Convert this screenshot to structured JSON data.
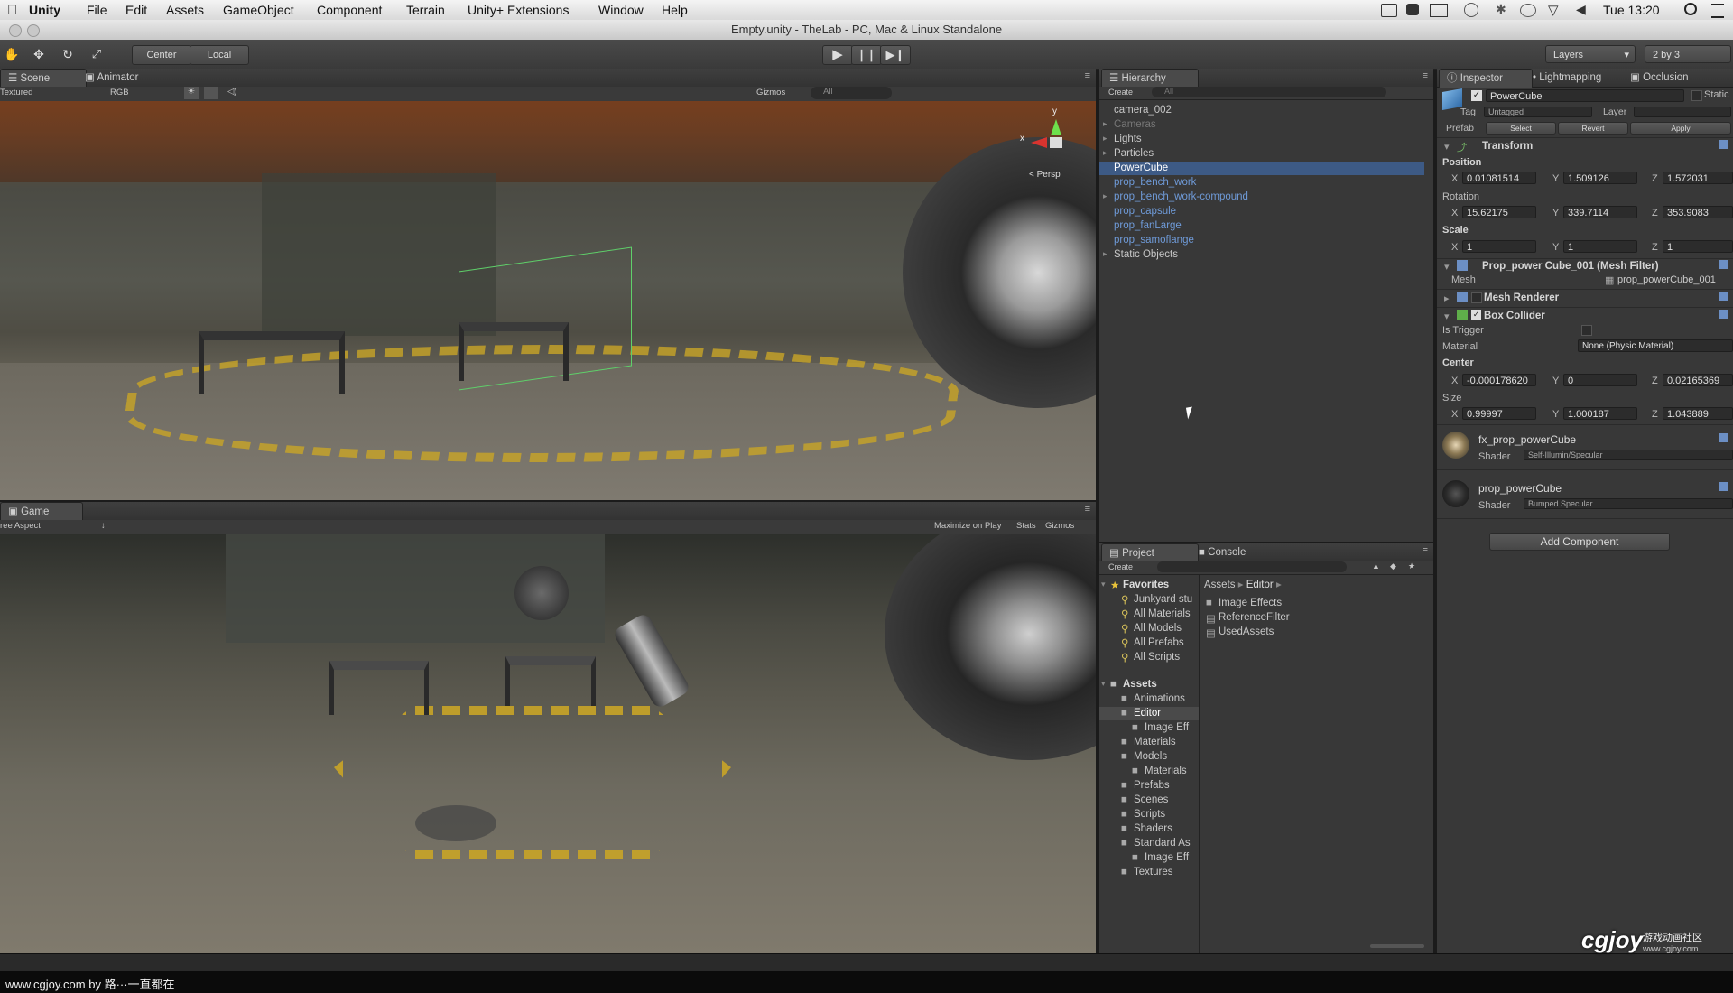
{
  "menubar": {
    "apple": "",
    "items": [
      "Unity",
      "File",
      "Edit",
      "Assets",
      "GameObject",
      "Component",
      "Terrain",
      "Unity+ Extensions",
      "Window",
      "Help"
    ],
    "clock": "Tue 13:20"
  },
  "window": {
    "title": "Empty.unity - TheLab - PC, Mac & Linux Standalone"
  },
  "toolbar": {
    "pivot": "Center",
    "space": "Local",
    "layers": "Layers",
    "layout": "2 by 3"
  },
  "scene": {
    "tabs": [
      "Scene",
      "Animator"
    ],
    "draw_mode": "Textured",
    "render_mode": "RGB",
    "gizmos": "Gizmos",
    "search": "All",
    "persp": "Persp",
    "axis_y": "y",
    "axis_x": "x"
  },
  "game": {
    "tab": "Game",
    "aspect": "ree Aspect",
    "maximize": "Maximize on Play",
    "stats": "Stats",
    "gizmos": "Gizmos"
  },
  "hierarchy": {
    "tab": "Hierarchy",
    "create": "Create",
    "search": "All",
    "items": [
      {
        "label": "camera_002",
        "style": "normal",
        "arrow": false
      },
      {
        "label": "Cameras",
        "style": "gray",
        "arrow": true
      },
      {
        "label": "Lights",
        "style": "normal",
        "arrow": true
      },
      {
        "label": "Particles",
        "style": "normal",
        "arrow": true
      },
      {
        "label": "PowerCube",
        "style": "selected",
        "arrow": false
      },
      {
        "label": "prop_bench_work",
        "style": "blue",
        "arrow": false
      },
      {
        "label": "prop_bench_work-compound",
        "style": "blue",
        "arrow": true
      },
      {
        "label": "prop_capsule",
        "style": "blue",
        "arrow": false
      },
      {
        "label": "prop_fanLarge",
        "style": "blue",
        "arrow": false
      },
      {
        "label": "prop_samoflange",
        "style": "blue",
        "arrow": false
      },
      {
        "label": "Static Objects",
        "style": "normal",
        "arrow": true
      }
    ]
  },
  "project": {
    "tabs": [
      "Project",
      "Console"
    ],
    "create": "Create",
    "favorites_label": "Favorites",
    "favorites": [
      "Junkyard stu",
      "All Materials",
      "All Models",
      "All Prefabs",
      "All Scripts"
    ],
    "assets_label": "Assets",
    "assets_tree": [
      {
        "label": "Animations",
        "indent": 1
      },
      {
        "label": "Editor",
        "indent": 1
      },
      {
        "label": "Image Eff",
        "indent": 2
      },
      {
        "label": "Materials",
        "indent": 1
      },
      {
        "label": "Models",
        "indent": 1
      },
      {
        "label": "Materials",
        "indent": 2
      },
      {
        "label": "Prefabs",
        "indent": 1
      },
      {
        "label": "Scenes",
        "indent": 1
      },
      {
        "label": "Scripts",
        "indent": 1
      },
      {
        "label": "Shaders",
        "indent": 1
      },
      {
        "label": "Standard As",
        "indent": 1
      },
      {
        "label": "Image Eff",
        "indent": 2
      },
      {
        "label": "Textures",
        "indent": 1
      }
    ],
    "breadcrumb": [
      "Assets",
      "Editor"
    ],
    "files": [
      "Image Effects",
      "ReferenceFilter",
      "UsedAssets"
    ]
  },
  "inspector": {
    "tabs": [
      "Inspector",
      "Lightmapping",
      "Occlusion"
    ],
    "object_name": "PowerCube",
    "static_label": "Static",
    "tag_label": "Tag",
    "tag_value": "Untagged",
    "layer_label": "Layer",
    "prefab_label": "Prefab",
    "prefab_buttons": [
      "Select",
      "Revert",
      "Apply"
    ],
    "transform": {
      "title": "Transform",
      "position_label": "Position",
      "position": {
        "x": "0.01081514",
        "y": "1.509126",
        "z": "1.572031"
      },
      "rotation_label": "Rotation",
      "rotation": {
        "x": "15.62175",
        "y": "339.7114",
        "z": "353.9083"
      },
      "scale_label": "Scale",
      "scale": {
        "x": "1",
        "y": "1",
        "z": "1"
      }
    },
    "mesh_filter": {
      "title": "Prop_power Cube_001 (Mesh Filter)",
      "mesh_label": "Mesh",
      "mesh_value": "prop_powerCube_001"
    },
    "mesh_renderer": {
      "title": "Mesh Renderer"
    },
    "box_collider": {
      "title": "Box Collider",
      "is_trigger_label": "Is Trigger",
      "material_label": "Material",
      "material_value": "None (Physic Material)",
      "center_label": "Center",
      "center": {
        "x": "-0.000178620",
        "y": "0",
        "z": "0.02165369"
      },
      "size_label": "Size",
      "size": {
        "x": "0.99997",
        "y": "1.000187",
        "z": "1.043889"
      }
    },
    "materials": [
      {
        "name": "fx_prop_powerCube",
        "shader_label": "Shader",
        "shader": "Self-Illumin/Specular"
      },
      {
        "name": "prop_powerCube",
        "shader_label": "Shader",
        "shader": "Bumped Specular"
      }
    ],
    "add_component": "Add Component"
  },
  "watermark": {
    "caption": "www.cgjoy.com by 路···一直都在",
    "logo": "cgjoy",
    "logo_sub": "游戏动画社区",
    "logo_url": "www.cgjoy.com"
  },
  "colors": {
    "panel": "#383838",
    "selection_blue": "#3d5a85",
    "prefab_blue": "#6f9bd9"
  }
}
